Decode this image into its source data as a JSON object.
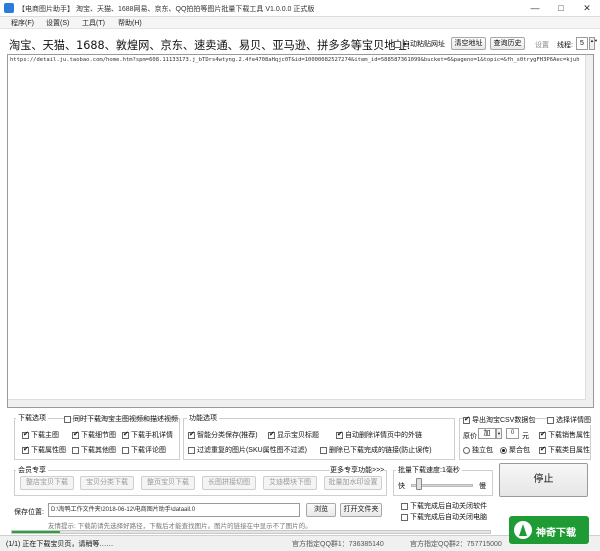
{
  "window": {
    "title": "【电商图片助手】 淘宝、天猫、1688网易、京东、QQ拍拍等图片批量下载工具 V1.0.0.0 正式版",
    "min_icon": "minimize-icon",
    "max_icon": "maximize-icon",
    "close_icon": "close-icon"
  },
  "menu": [
    "程序(F)",
    "设置(S)",
    "工具(T)",
    "帮助(H)"
  ],
  "header": {
    "label": "淘宝、天猫、1688、敦煌网、京东、速卖通、易贝、亚马逊、拼多多等宝贝地址:",
    "auto_paste": "自动粘贴网址",
    "clear_btn": "清空地址",
    "history_btn": "查询历史",
    "settings": "设置",
    "threads_label": "线程:",
    "threads_value": "5"
  },
  "url_text": "https://detail.ju.taobao.com/home.htm?spm=608.11133173.j_bTDrs4wtyng.2.4fe4708aHqjc0T&id=10000082527274&item_id=588587361099&bucket=6&pageno=1&topic=&fh_s0trygFH3P6Aec=kjuh",
  "download_options": {
    "label": "下载选项",
    "extra": "同时下载淘宝主图视频和描述视频",
    "items": [
      {
        "label": "下载主图",
        "checked": true
      },
      {
        "label": "下载细节图",
        "checked": true
      },
      {
        "label": "下载手机详情",
        "checked": true
      },
      {
        "label": "下载属性图",
        "checked": true
      },
      {
        "label": "下载其他图",
        "checked": false
      },
      {
        "label": "下载评论图",
        "checked": false
      }
    ]
  },
  "function_options": {
    "label": "功能选项",
    "items": [
      {
        "label": "智能分类保存(推荐)",
        "checked": true
      },
      {
        "label": "显示宝贝标题",
        "checked": true
      },
      {
        "label": "自动删除详情页中的外链",
        "checked": true
      },
      {
        "label": "过滤重复的图片(SKU属性图不过滤)",
        "checked": false
      },
      {
        "label": "删除已下载完成的链接(防止误传)",
        "checked": false
      }
    ]
  },
  "right_options": {
    "export_csv": "导出淘宝CSV数据包",
    "export_csv_checked": true,
    "selected_detail": "选择详情图",
    "selected_detail_checked": false,
    "price_label": "原价",
    "price_op": "加",
    "price_value": "0",
    "price_unit": "元",
    "sales_attr": "下载销售属性",
    "sales_attr_checked": true,
    "radio_single": "独立包",
    "radio_multi": "聚合包",
    "radio_selected": "聚合包",
    "color_attr": "下载类目属性",
    "color_attr_checked": true
  },
  "member": {
    "label": "会员专享",
    "more": "更多专享功能>>>",
    "buttons": [
      "整店宝贝下载",
      "宝贝分类下载",
      "整页宝贝下载",
      "长图拼接切图",
      "艾迪模块下图",
      "批量加水印设置"
    ]
  },
  "speed": {
    "label": "批量下载速度:1毫秒",
    "fast": "快",
    "slow": "慢",
    "level": 0.05
  },
  "save": {
    "label": "保存位置:",
    "path": "D:\\淘鸭工作文件夹\\2018-06-12\\电商图片助手\\dataall.0",
    "browse_btn": "浏览",
    "open_btn": "打开文件夹",
    "tip": "友情提示: 下载前请先选择好路径，下载后才能查找图片。图片的链接在中显示不了图片的。"
  },
  "after_options": [
    "下载完成后自动关闭软件",
    "下载完成后自动关闭电脑"
  ],
  "stop_btn": "停止",
  "status": {
    "left": "(1/1) 正在下载宝贝页，请稍等……",
    "mid": "官方指定QQ群1：736385140",
    "right": "官方指定QQ群2：757715000",
    "progress": 0.1
  },
  "watermark": {
    "logo_icon": "mountain-logo-icon",
    "text": "神奇下载"
  }
}
